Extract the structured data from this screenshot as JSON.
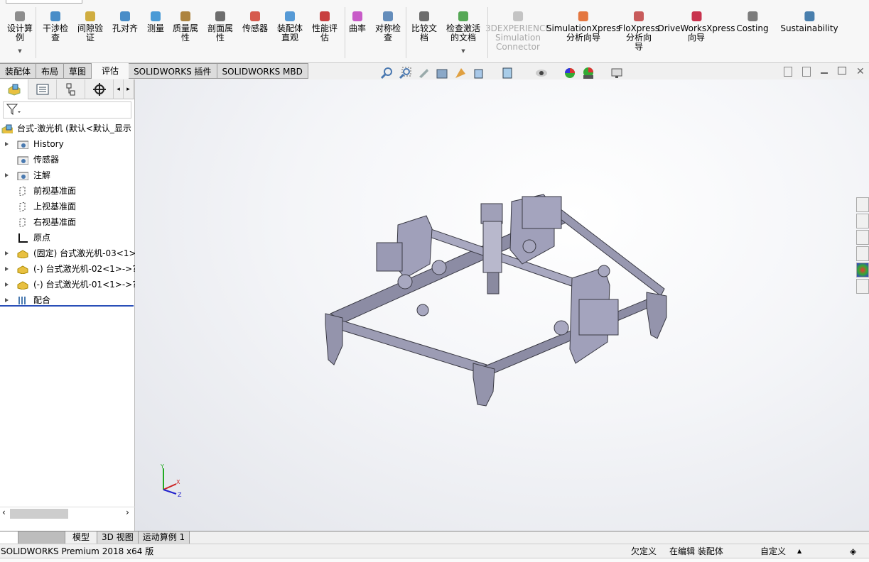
{
  "ribbon": {
    "buttons": [
      {
        "label": "设计算\n例",
        "icon": "design-study-icon",
        "dropdown": true
      },
      {
        "label": "干涉检\n查",
        "icon": "interference-icon"
      },
      {
        "label": "间隙验\n证",
        "icon": "clearance-icon"
      },
      {
        "label": "孔对齐",
        "icon": "hole-align-icon"
      },
      {
        "label": "测量",
        "icon": "measure-icon"
      },
      {
        "label": "质量属\n性",
        "icon": "mass-properties-icon"
      },
      {
        "label": "剖面属\n性",
        "icon": "section-properties-icon"
      },
      {
        "label": "传感器",
        "icon": "sensor-icon"
      },
      {
        "label": "装配体\n直观",
        "icon": "assembly-visualization-icon"
      },
      {
        "label": "性能评\n估",
        "icon": "performance-icon"
      },
      {
        "label": "曲率",
        "icon": "curvature-icon"
      },
      {
        "label": "对称检\n查",
        "icon": "symmetry-icon"
      },
      {
        "label": "比较文\n档",
        "icon": "compare-icon"
      },
      {
        "label": "检查激活\n的文档",
        "icon": "check-document-icon",
        "dropdown": true
      },
      {
        "label": "3DEXPERIENCE\nSimulation\nConnector",
        "icon": "3dexperience-icon",
        "disabled": true
      },
      {
        "label": "SimulationXpress\n分析向导",
        "icon": "simulationxpress-icon"
      },
      {
        "label": "FloXpress\n分析向\n导",
        "icon": "floxpress-icon"
      },
      {
        "label": "DriveWorksXpress\n向导",
        "icon": "driveworks-icon"
      },
      {
        "label": "Costing",
        "icon": "costing-icon"
      },
      {
        "label": "Sustainability",
        "icon": "sustainability-icon"
      }
    ]
  },
  "tabs": [
    "装配体",
    "布局",
    "草图",
    "评估",
    "SOLIDWORKS 插件",
    "SOLIDWORKS MBD"
  ],
  "active_tab": "评估",
  "tree": {
    "root": "台式-激光机  (默认<默认_显示",
    "items": [
      {
        "label": "History",
        "icon": "history-folder-icon",
        "expand": true
      },
      {
        "label": "传感器",
        "icon": "sensor-folder-icon",
        "expand": false
      },
      {
        "label": "注解",
        "icon": "annotation-folder-icon",
        "expand": true
      },
      {
        "label": "前视基准面",
        "icon": "plane-icon",
        "expand": false
      },
      {
        "label": "上视基准面",
        "icon": "plane-icon",
        "expand": false
      },
      {
        "label": "右视基准面",
        "icon": "plane-icon",
        "expand": false
      },
      {
        "label": "原点",
        "icon": "origin-icon",
        "expand": false
      },
      {
        "label": "(固定) 台式激光机-03<1>",
        "icon": "part-icon",
        "expand": true
      },
      {
        "label": "(-) 台式激光机-02<1>->?",
        "icon": "part-icon",
        "expand": true
      },
      {
        "label": "(-) 台式激光机-01<1>->?",
        "icon": "part-icon",
        "expand": true
      },
      {
        "label": "配合",
        "icon": "mates-icon",
        "expand": true
      }
    ]
  },
  "bottom_tabs": [
    "模型",
    "3D 视图",
    "运动算例 1"
  ],
  "status": {
    "product": "SOLIDWORKS Premium 2018 x64 版",
    "state": "欠定义",
    "mode": "在编辑 装配体",
    "units": "自定义"
  },
  "triad": {
    "y": "Y",
    "x": "X",
    "z": "Z"
  }
}
